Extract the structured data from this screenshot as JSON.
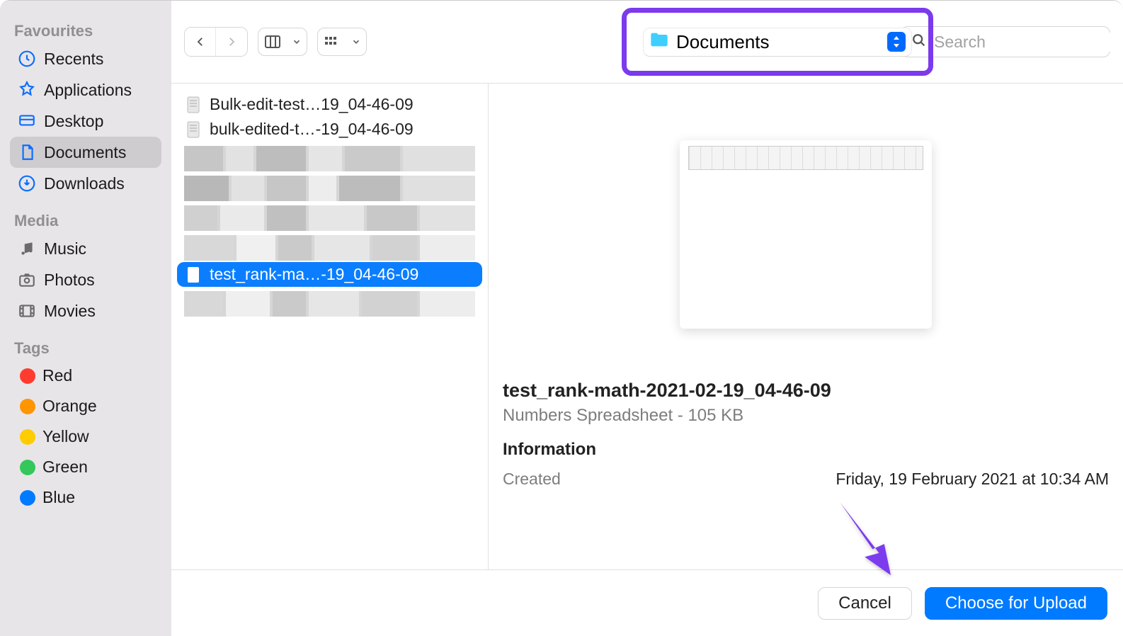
{
  "sidebar": {
    "groups": [
      {
        "heading": "Favourites",
        "items": [
          {
            "icon": "clock",
            "label": "Recents"
          },
          {
            "icon": "app",
            "label": "Applications"
          },
          {
            "icon": "desktop",
            "label": "Desktop"
          },
          {
            "icon": "doc",
            "label": "Documents",
            "selected": true
          },
          {
            "icon": "download",
            "label": "Downloads"
          }
        ]
      },
      {
        "heading": "Media",
        "items": [
          {
            "icon": "music",
            "label": "Music"
          },
          {
            "icon": "photos",
            "label": "Photos"
          },
          {
            "icon": "movies",
            "label": "Movies"
          }
        ]
      },
      {
        "heading": "Tags",
        "items": [
          {
            "color": "#ff3b30",
            "label": "Red"
          },
          {
            "color": "#ff9500",
            "label": "Orange"
          },
          {
            "color": "#ffcc00",
            "label": "Yellow"
          },
          {
            "color": "#34c759",
            "label": "Green"
          },
          {
            "color": "#007aff",
            "label": "Blue"
          }
        ]
      }
    ]
  },
  "toolbar": {
    "path_label": "Documents",
    "search_placeholder": "Search"
  },
  "files": [
    {
      "name": "Bulk-edit-test…19_04-46-09",
      "icon": "spreadsheet",
      "selected": false
    },
    {
      "name": "bulk-edited-t…-19_04-46-09",
      "icon": "spreadsheet",
      "selected": false
    },
    {
      "name": "",
      "blurred": true
    },
    {
      "name": "",
      "blurred": true
    },
    {
      "name": "",
      "blurred": true
    },
    {
      "name": "",
      "blurred": true
    },
    {
      "name": "test_rank-ma…-19_04-46-09",
      "icon": "spreadsheet-white",
      "selected": true
    },
    {
      "name": "",
      "blurred": true
    }
  ],
  "preview": {
    "title": "test_rank-math-2021-02-19_04-46-09",
    "subtitle": "Numbers Spreadsheet - 105 KB",
    "info_heading": "Information",
    "meta": [
      {
        "label": "Created",
        "value": "Friday, 19 February 2021 at 10:34 AM"
      }
    ]
  },
  "buttons": {
    "cancel": "Cancel",
    "submit": "Choose for Upload"
  },
  "annotation": {
    "highlight_color": "#7c3aed"
  }
}
